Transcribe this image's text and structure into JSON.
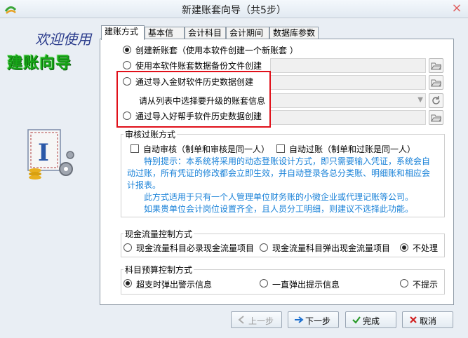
{
  "window": {
    "title": "新建账套向导（共5步）",
    "close": "×"
  },
  "left": {
    "welcome": "欢迎使用",
    "wizard_title": "建账向导",
    "illus_letter": "I"
  },
  "tabs": [
    "建账方式",
    "基本信息",
    "会计科目",
    "会计期间",
    "数据库参数"
  ],
  "mode": {
    "opt_new": "创建新账套（使用本软件创建一个新账套 ）",
    "opt_backup": "使用本软件账套数据备份文件创建",
    "opt_jincai": "通过导入金财软件历史数据创建",
    "jincai_hint": "请从列表中选择要升级的账套信息",
    "opt_haobang": "通过导入好帮手软件历史数据创建",
    "selected": "opt_new"
  },
  "audit": {
    "title": "审核过账方式",
    "auto_audit": "自动审核（制单和审核是同一人）",
    "auto_post": "自动过账（制单和过账是同一人）",
    "tip1_l1": "特别提示：本系统将采用的动态登账设计方式，即只需要输入凭证，系统会自",
    "tip1_l2": "动过账，所有凭证的修改都会立即生效，并自动登录各总分类账、明细账和相应会",
    "tip1_l3": "计报表。",
    "tip2_l1": "此方式适用于只有一个人管理单位财务账的小微企业或代理记账等公司。",
    "tip2_l2": "如果贵单位会计岗位设置齐全，且人员分工明细，则建议不选择此功能。"
  },
  "cashflow": {
    "title": "现金流量控制方式",
    "opt1": "现金流量科目必录现金流量项目",
    "opt2": "现金流量科目弹出现金流量项目",
    "opt3": "不处理",
    "selected": "opt3"
  },
  "budget": {
    "title": "科目预算控制方式",
    "opt1": "超支时弹出警示信息",
    "opt2": "一直弹出提示信息",
    "opt3": "不提示",
    "selected": "opt1"
  },
  "buttons": {
    "prev": "上一步",
    "next": "下一步",
    "finish": "完成",
    "cancel": "取消"
  },
  "colors": {
    "accent_green": "#17a617",
    "tip_blue": "#1a82d8",
    "highlight_red": "#e0101a"
  }
}
